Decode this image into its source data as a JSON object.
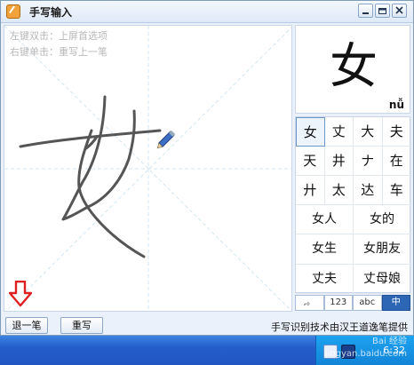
{
  "window": {
    "title": "手写输入"
  },
  "canvas": {
    "hint_line1": "左键双击：上屏首选项",
    "hint_line2": "右键单击：重写上一笔"
  },
  "preview": {
    "character": "女",
    "pinyin": "nǚ"
  },
  "candidates": {
    "singles": [
      [
        "女",
        "丈",
        "大",
        "夫"
      ],
      [
        "天",
        "井",
        "ナ",
        "在"
      ],
      [
        "廾",
        "太",
        "达",
        "车"
      ]
    ],
    "words": [
      [
        "女人",
        "女的"
      ],
      [
        "女生",
        "女朋友"
      ],
      [
        "丈夫",
        "丈母娘"
      ]
    ]
  },
  "modes": [
    ",。",
    "123",
    "abc",
    "中"
  ],
  "actions": {
    "undo_stroke": "退一笔",
    "rewrite": "重写"
  },
  "credit": "手写识别技术由汉王道逸笔提供",
  "taskbar": {
    "clock": "6:32"
  },
  "watermark": {
    "line1": "Bai 经验",
    "line2": "jingyan.baidu.com"
  },
  "colors": {
    "accent": "#2d66b5",
    "arrow": "#e02020"
  }
}
